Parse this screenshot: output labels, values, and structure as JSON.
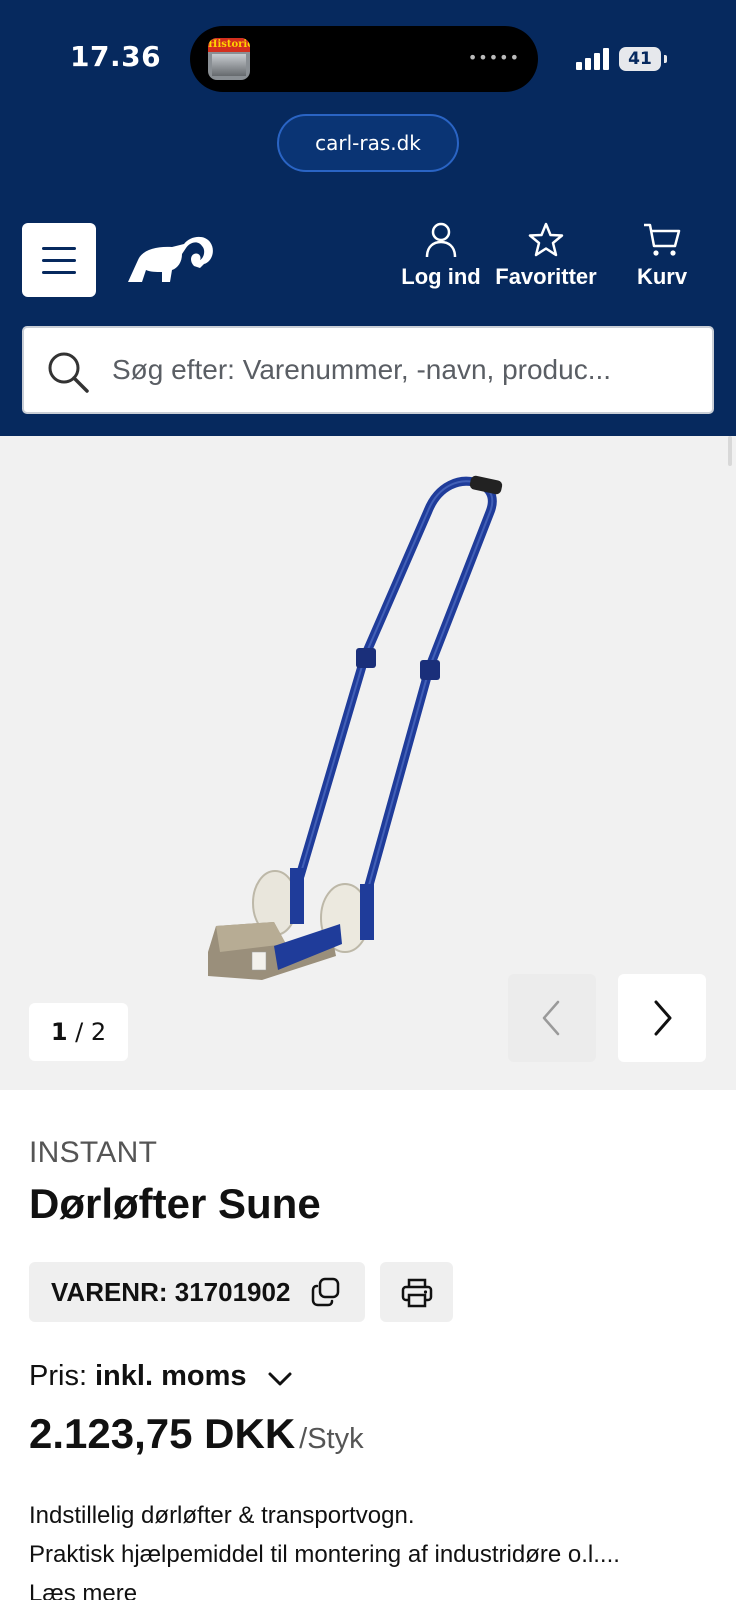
{
  "status_bar": {
    "time": "17.36",
    "island_app_badge": "Historie",
    "island_dots": "•••••",
    "battery": "41"
  },
  "browser": {
    "url": "carl-ras.dk"
  },
  "nav": {
    "login_label": "Log ind",
    "favorites_label": "Favoritter",
    "cart_label": "Kurv"
  },
  "search": {
    "placeholder": "Søg efter: Varenummer, -navn, produc..."
  },
  "gallery": {
    "current": "1",
    "separator": " / ",
    "total": "2"
  },
  "product": {
    "brand": "INSTANT",
    "title": "Dørløfter Sune",
    "sku_label": "VARENR: 31701902",
    "price_prefix": "Pris:",
    "price_mode": "inkl. moms",
    "price": "2.123,75 DKK",
    "unit": "/Styk",
    "desc_line1": "Indstillelig dørløfter & transportvogn.",
    "desc_line2": "Praktisk hjælpemiddel til montering af industridøre o.l....",
    "read_more": "Læs mere"
  },
  "colors": {
    "brand_navy": "#06295e",
    "gallery_bg": "#f1f1f1",
    "product_blue": "#1f3c9a"
  }
}
